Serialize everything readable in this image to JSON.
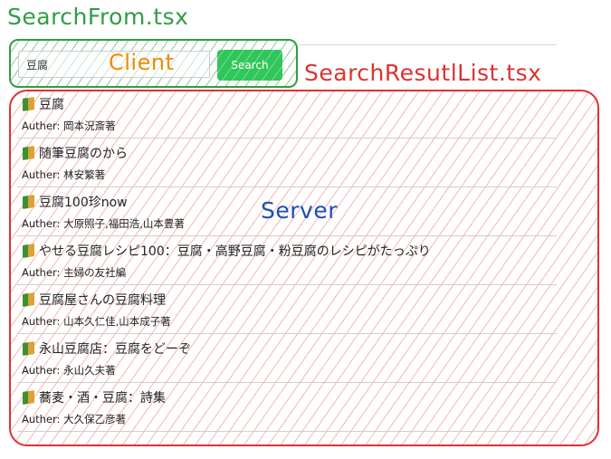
{
  "labels": {
    "search_form": "SearchFrom.tsx",
    "result_list": "SearchResutlList.tsx",
    "client": "Client",
    "server": "Server"
  },
  "search": {
    "value": "豆腐",
    "button_label": "Search"
  },
  "author_prefix": "Auther:",
  "results": [
    {
      "title": "豆腐",
      "author": "岡本況斎著"
    },
    {
      "title": "随筆豆腐のから",
      "author": "林安繁著"
    },
    {
      "title": "豆腐100珍now",
      "author": "大原照子,福田浩,山本豊著"
    },
    {
      "title": "やせる豆腐レシピ100：豆腐・高野豆腐・粉豆腐のレシピがたっぷり",
      "author": "主婦の友社編"
    },
    {
      "title": "豆腐屋さんの豆腐料理",
      "author": "山本久仁佳,山本成子著"
    },
    {
      "title": "永山豆腐店：豆腐をどーぞ",
      "author": "永山久夫著"
    },
    {
      "title": "蕎麦・酒・豆腐：詩集",
      "author": "大久保乙彦著"
    }
  ],
  "colors": {
    "client_border": "#2f9e44",
    "server_border": "#e03131",
    "client_label": "#f08c00",
    "server_label": "#1c4fb5",
    "search_button": "#2fc65a"
  }
}
